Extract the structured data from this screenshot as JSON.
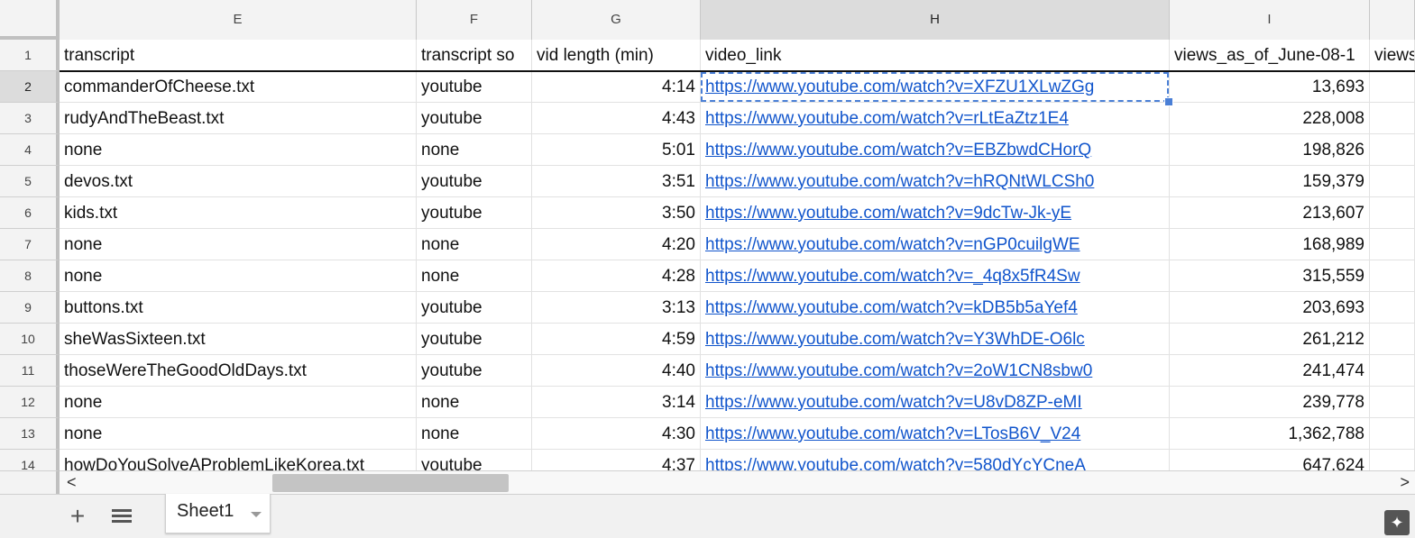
{
  "columns": [
    {
      "letter": "E",
      "name": "transcript"
    },
    {
      "letter": "F",
      "name": "transcript so"
    },
    {
      "letter": "G",
      "name": "vid length (min)"
    },
    {
      "letter": "H",
      "name": "video_link"
    },
    {
      "letter": "I",
      "name": "views_as_of_June-08-1"
    },
    {
      "letter": "",
      "name": "views"
    }
  ],
  "rows": [
    {
      "num": "2",
      "transcript": "commanderOfCheese.txt",
      "source": "youtube",
      "length": "4:14",
      "link": "https://www.youtube.com/watch?v=XFZU1XLwZGg",
      "views": "13,693"
    },
    {
      "num": "3",
      "transcript": "rudyAndTheBeast.txt",
      "source": "youtube",
      "length": "4:43",
      "link": "https://www.youtube.com/watch?v=rLtEaZtz1E4",
      "views": "228,008"
    },
    {
      "num": "4",
      "transcript": "none",
      "source": "none",
      "length": "5:01",
      "link": "https://www.youtube.com/watch?v=EBZbwdCHorQ",
      "views": "198,826"
    },
    {
      "num": "5",
      "transcript": "devos.txt",
      "source": "youtube",
      "length": "3:51",
      "link": "https://www.youtube.com/watch?v=hRQNtWLCSh0",
      "views": "159,379"
    },
    {
      "num": "6",
      "transcript": "kids.txt",
      "source": "youtube",
      "length": "3:50",
      "link": "https://www.youtube.com/watch?v=9dcTw-Jk-yE",
      "views": "213,607"
    },
    {
      "num": "7",
      "transcript": "none",
      "source": "none",
      "length": "4:20",
      "link": "https://www.youtube.com/watch?v=nGP0cuilgWE",
      "views": "168,989"
    },
    {
      "num": "8",
      "transcript": "none",
      "source": "none",
      "length": "4:28",
      "link": "https://www.youtube.com/watch?v=_4q8x5fR4Sw",
      "views": "315,559"
    },
    {
      "num": "9",
      "transcript": "buttons.txt",
      "source": "youtube",
      "length": "3:13",
      "link": "https://www.youtube.com/watch?v=kDB5b5aYef4",
      "views": "203,693"
    },
    {
      "num": "10",
      "transcript": "sheWasSixteen.txt",
      "source": "youtube",
      "length": "4:59",
      "link": "https://www.youtube.com/watch?v=Y3WhDE-O6lc",
      "views": "261,212"
    },
    {
      "num": "11",
      "transcript": "thoseWereTheGoodOldDays.txt",
      "source": "youtube",
      "length": "4:40",
      "link": "https://www.youtube.com/watch?v=2oW1CN8sbw0",
      "views": "241,474"
    },
    {
      "num": "12",
      "transcript": "none",
      "source": "none",
      "length": "3:14",
      "link": "https://www.youtube.com/watch?v=U8vD8ZP-eMI",
      "views": "239,778"
    },
    {
      "num": "13",
      "transcript": "none",
      "source": "none",
      "length": "4:30",
      "link": "https://www.youtube.com/watch?v=LTosB6V_V24",
      "views": "1,362,788"
    },
    {
      "num": "14",
      "transcript": "howDoYouSolveAProblemLikeKorea.txt",
      "source": "youtube",
      "length": "4:37",
      "link": "https://www.youtube.com/watch?v=580dYcYCneA",
      "views": "647,624"
    }
  ],
  "header_row_num": "1",
  "sheet_tab": {
    "label": "Sheet1"
  },
  "bottom_bar": {
    "add_icon": "plus-icon",
    "list_icon": "sheet-list-icon",
    "explore_icon": "explore-icon"
  },
  "scroll": {
    "left_icon": "chevron-left-icon",
    "right_icon": "chevron-right-icon",
    "left_glyph": "<",
    "right_glyph": ">"
  },
  "colors": {
    "link": "#1155cc",
    "selection": "#4a7fd6",
    "header_bg": "#f3f3f3"
  }
}
